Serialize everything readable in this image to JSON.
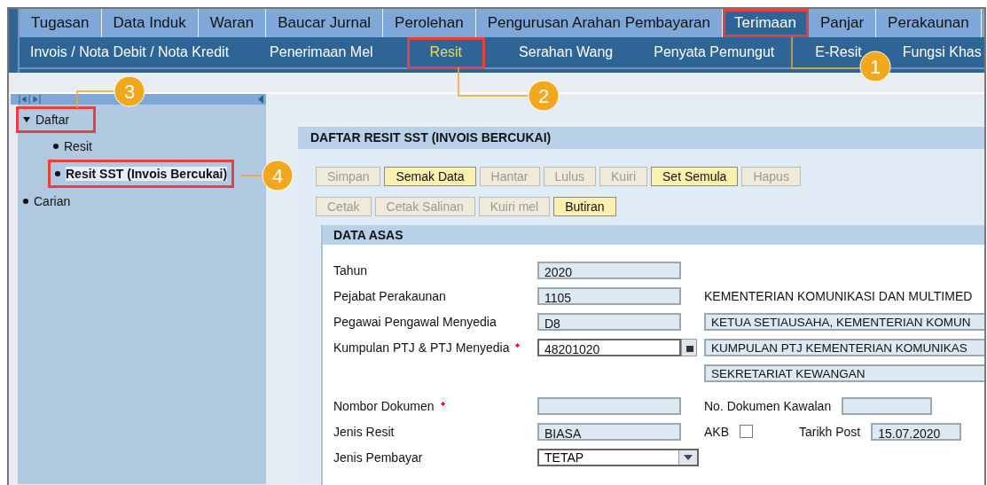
{
  "menu": [
    {
      "label": "Tugasan",
      "selected": false,
      "highlighted": false
    },
    {
      "label": "Data Induk",
      "selected": false,
      "highlighted": false
    },
    {
      "label": "Waran",
      "selected": false,
      "highlighted": false
    },
    {
      "label": "Baucar Jurnal",
      "selected": false,
      "highlighted": false
    },
    {
      "label": "Perolehan",
      "selected": false,
      "highlighted": false
    },
    {
      "label": "Pengurusan Arahan Pembayaran",
      "selected": false,
      "highlighted": false
    },
    {
      "label": "Terimaan",
      "selected": true,
      "highlighted": true
    },
    {
      "label": "Panjar",
      "selected": false,
      "highlighted": false
    },
    {
      "label": "Perakaunan",
      "selected": false,
      "highlighted": false
    }
  ],
  "submenu": [
    {
      "label": "Invois / Nota Debit / Nota Kredit",
      "selected": false,
      "highlighted": false
    },
    {
      "label": "Penerimaan Mel",
      "selected": false,
      "highlighted": false
    },
    {
      "label": "Resit",
      "selected": true,
      "highlighted": true
    },
    {
      "label": "Serahan Wang",
      "selected": false,
      "highlighted": false
    },
    {
      "label": "Penyata Pemungut",
      "selected": false,
      "highlighted": false
    },
    {
      "label": "E-Resit",
      "selected": false,
      "highlighted": false
    },
    {
      "label": "Fungsi Khas",
      "selected": false,
      "highlighted": false
    }
  ],
  "tree": [
    {
      "label": "Daftar",
      "expanded": true,
      "selected": false,
      "highlighted": true,
      "children": [
        {
          "label": "Resit",
          "selected": false,
          "highlighted": false
        },
        {
          "label": "Resit SST (Invois Bercukai)",
          "selected": true,
          "highlighted": true
        }
      ]
    },
    {
      "label": "Carian",
      "selected": false,
      "highlighted": false
    }
  ],
  "panel": {
    "title": "DAFTAR RESIT SST (INVOIS BERCUKAI)",
    "button_rows": [
      [
        {
          "label": "Simpan",
          "disabled": true
        },
        {
          "label": "Semak Data",
          "disabled": false
        },
        {
          "label": "Hantar",
          "disabled": true
        },
        {
          "label": "Lulus",
          "disabled": true
        },
        {
          "label": "Kuiri",
          "disabled": true
        },
        {
          "label": "Set Semula",
          "disabled": false
        },
        {
          "label": "Hapus",
          "disabled": true
        }
      ],
      [
        {
          "label": "Cetak",
          "disabled": true
        },
        {
          "label": "Cetak Salinan",
          "disabled": true
        },
        {
          "label": "Kuiri mel",
          "disabled": true
        },
        {
          "label": "Butiran",
          "disabled": false
        }
      ]
    ],
    "section": {
      "title": "DATA ASAS",
      "rows": [
        {
          "label": "Tahun",
          "required": false,
          "field": {
            "kind": "text",
            "value": "2020",
            "editable": false
          }
        },
        {
          "label": "Pejabat Perakaunan",
          "required": false,
          "field": {
            "kind": "text",
            "value": "1105",
            "editable": false
          },
          "extras": [
            {
              "kind": "description",
              "text": "KEMENTERIAN KOMUNIKASI DAN MULTIMED"
            }
          ]
        },
        {
          "label": "Pegawai Pengawal Menyedia",
          "required": false,
          "field": {
            "kind": "text",
            "value": "D8",
            "editable": false
          },
          "extras": [
            {
              "kind": "output",
              "text": "KETUA SETIAUSAHA, KEMENTERIAN KOMUN"
            }
          ]
        },
        {
          "label": "Kumpulan PTJ & PTJ Menyedia",
          "required": true,
          "field": {
            "kind": "lookup",
            "value": "48201020",
            "editable": true
          },
          "extras": [
            {
              "kind": "output",
              "text": "KUMPULAN PTJ  KEMENTERIAN KOMUNIKAS"
            }
          ]
        },
        {
          "extras": [
            {
              "kind": "output",
              "text": "SEKRETARIAT KEWANGAN"
            }
          ]
        },
        {
          "label": "Nombor Dokumen",
          "required": true,
          "field": {
            "kind": "text",
            "editable": false
          },
          "extras": [
            {
              "kind": "description",
              "text": "No. Dokumen Kawalan"
            },
            {
              "kind": "field",
              "editable": false
            }
          ]
        },
        {
          "label": "Jenis Resit",
          "required": false,
          "field": {
            "kind": "text",
            "value": "BIASA",
            "editable": false
          },
          "extras": [
            {
              "kind": "description",
              "text": "AKB"
            },
            {
              "kind": "checkbox",
              "checked": false
            },
            {
              "kind": "description",
              "text": "Tarikh Post"
            },
            {
              "kind": "field",
              "text": "15.07.2020",
              "editable": false
            }
          ]
        },
        {
          "label": "Jenis Pembayar",
          "required": false,
          "field": {
            "kind": "dropdown",
            "value": "TETAP",
            "editable": true
          }
        }
      ]
    }
  },
  "callouts": [
    {
      "number": "1"
    },
    {
      "number": "2"
    },
    {
      "number": "3"
    },
    {
      "number": "4"
    }
  ]
}
